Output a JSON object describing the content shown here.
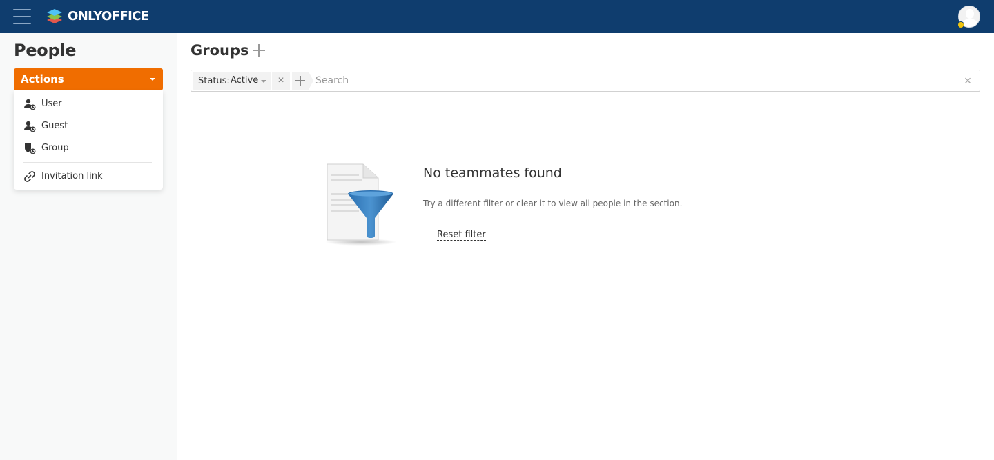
{
  "header": {
    "brand": "ONLYOFFICE",
    "menu_icon": "hamburger-icon",
    "logo_icon": "onlyoffice-logo-icon",
    "avatar_icon": "user-avatar-icon",
    "colors": {
      "bar": "#0f3d6e",
      "accent": "#f06d00"
    }
  },
  "sidebar": {
    "title": "People",
    "actions_label": "Actions",
    "menu": [
      {
        "label": "User",
        "icon": "add-user-icon"
      },
      {
        "label": "Guest",
        "icon": "add-guest-icon"
      },
      {
        "label": "Group",
        "icon": "add-group-icon"
      },
      {
        "label": "Invitation link",
        "icon": "link-icon"
      }
    ]
  },
  "main": {
    "title": "Groups",
    "filter": {
      "chip_key": "Status:",
      "chip_value": "Active",
      "search_placeholder": "Search"
    },
    "empty": {
      "title": "No teammates found",
      "description": "Try a different filter or clear it to view all people in the section.",
      "reset_label": "Reset filter",
      "illustration_icon": "filter-document-icon"
    }
  }
}
